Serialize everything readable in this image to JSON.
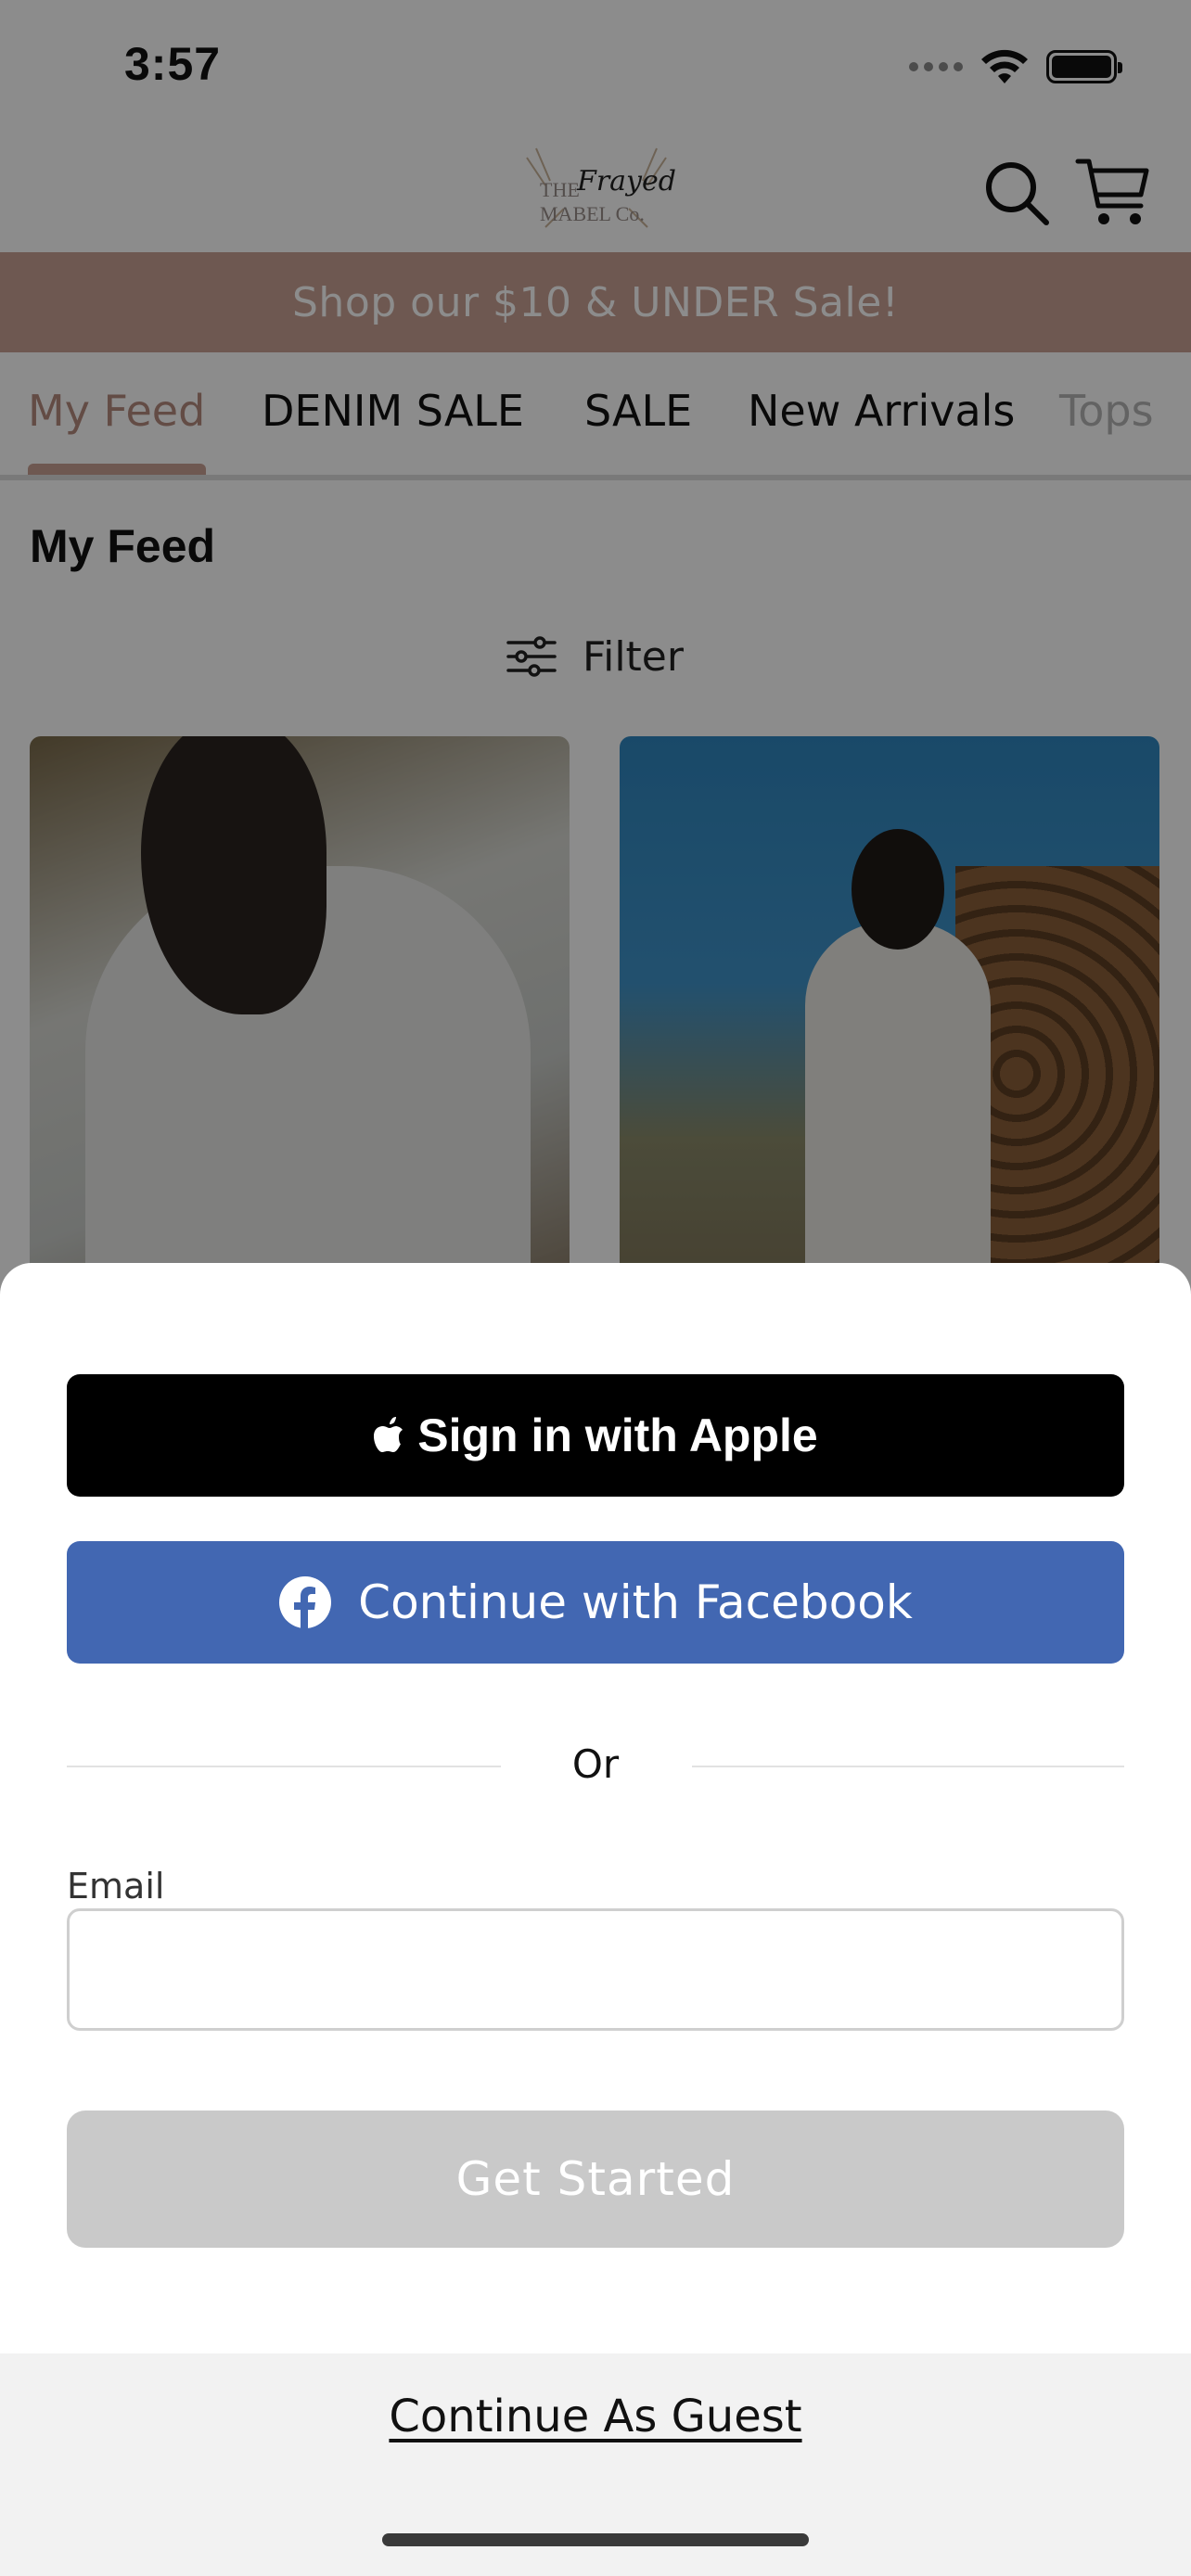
{
  "status_bar": {
    "time": "3:57",
    "icons": [
      "cellular-signal-icon",
      "wifi-icon",
      "battery-icon"
    ]
  },
  "header": {
    "logo": {
      "line_1": "THE",
      "line_2": "Frayed",
      "line_3": "MABEL Co."
    },
    "icons": [
      "search-icon",
      "cart-icon"
    ]
  },
  "promo_banner": {
    "text": "Shop our $10 & UNDER Sale!",
    "background_color": "#c9a194"
  },
  "tabs": [
    {
      "label": "My Feed",
      "active": true
    },
    {
      "label": "DENIM SALE",
      "active": false
    },
    {
      "label": "SALE",
      "active": false
    },
    {
      "label": "New Arrivals",
      "active": false
    },
    {
      "label": "Tops",
      "active": false
    }
  ],
  "feed": {
    "title": "My Feed",
    "filter_label": "Filter",
    "filter_icon": "sliders-icon"
  },
  "sheet": {
    "apple_button_label": "Sign in with Apple",
    "apple_icon": "apple-icon",
    "facebook_button_label": "Continue with Facebook",
    "facebook_icon": "facebook-icon",
    "facebook_color": "#4267b2",
    "or_text": "Or",
    "email_label": "Email",
    "email_value": "",
    "get_started_label": "Get Started",
    "guest_link_label": "Continue As Guest"
  }
}
